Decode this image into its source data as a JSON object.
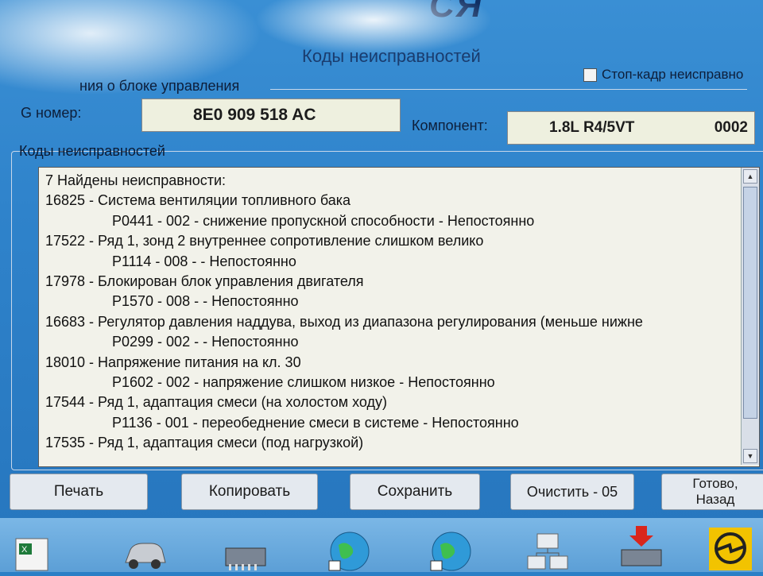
{
  "header": {
    "window_title": "Коды неисправностей",
    "freeze_frame_label": "Стоп-кадр неисправно",
    "ecu_group_label": "ния о блоке управления"
  },
  "ecu": {
    "part_label": "G номер:",
    "part_value": "8E0 909 518 AC",
    "component_label": "Компонент:",
    "component_value": "1.8L R4/5VT",
    "component_code": "0002"
  },
  "faults": {
    "group_label": "Коды неисправностей",
    "summary": "7 Найдены неисправности:",
    "rows": [
      {
        "text": "16825 - Система вентиляции топливного бака",
        "sub": false
      },
      {
        "text": "P0441 - 002 - снижение пропускной способности - Непостоянно",
        "sub": true
      },
      {
        "text": "17522 - Ряд 1, зонд 2 внутреннее сопротивление слишком велико",
        "sub": false
      },
      {
        "text": "P1114 - 008 -  - Непостоянно",
        "sub": true
      },
      {
        "text": "17978 - Блокирован блок управления двигателя",
        "sub": false
      },
      {
        "text": "P1570 - 008 -  - Непостоянно",
        "sub": true
      },
      {
        "text": "16683 - Регулятор давления наддува, выход из диапазона регулирования (меньше нижне",
        "sub": false
      },
      {
        "text": "P0299 - 002 -  - Непостоянно",
        "sub": true
      },
      {
        "text": "18010 - Напряжение питания на кл. 30",
        "sub": false
      },
      {
        "text": "P1602 - 002 - напряжение слишком низкое - Непостоянно",
        "sub": true
      },
      {
        "text": "17544 - Ряд 1, адаптация смеси (на холостом ходу)",
        "sub": false
      },
      {
        "text": "P1136 - 001 - переобеднение смеси в системе - Непостоянно",
        "sub": true
      },
      {
        "text": "17535 - Ряд 1, адаптация смеси (под нагрузкой)",
        "sub": false
      }
    ]
  },
  "buttons": {
    "print": "Печать",
    "copy": "Копировать",
    "save": "Сохранить",
    "clear": "Очистить - 05",
    "done": "Готово, Назад"
  },
  "icons": {
    "taskbar": [
      "excel-icon",
      "car-icon",
      "chip-icon",
      "globe-icon",
      "globe-icon",
      "network-icon",
      "download-chip-icon",
      "opel-icon"
    ]
  },
  "colors": {
    "window_bg": "#2f83cb",
    "list_bg": "#f2f2ea",
    "field_bg": "#eef0df"
  }
}
